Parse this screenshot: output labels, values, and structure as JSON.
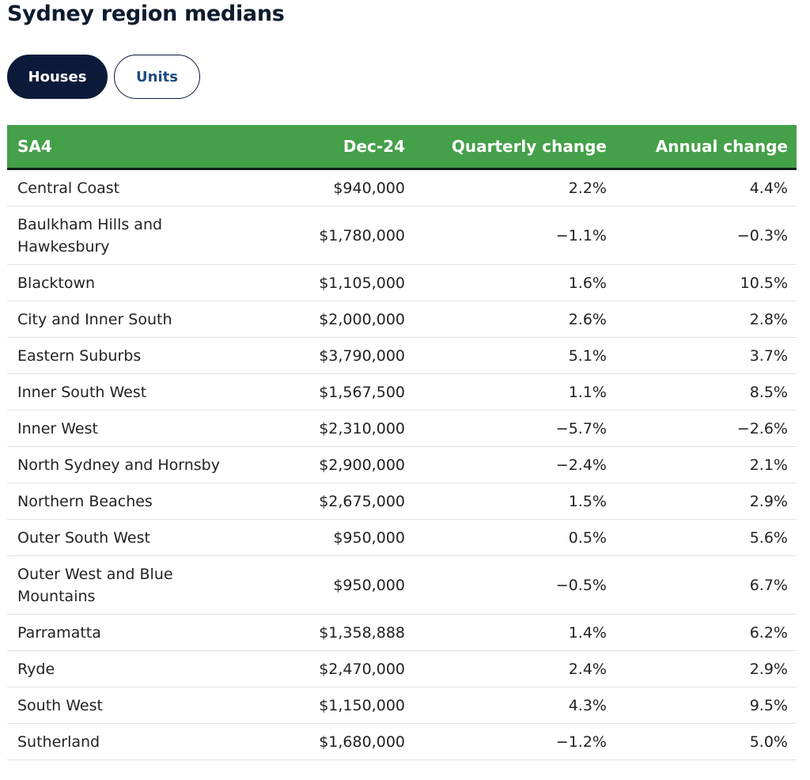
{
  "title": "Sydney region medians",
  "toggle": {
    "houses": "Houses",
    "units": "Units",
    "selected": "Houses"
  },
  "colors": {
    "header_bg": "#45a04a",
    "active_button": "#0c1a3a",
    "units_text": "#1d4c80"
  },
  "table": {
    "headers": [
      "SA4",
      "Dec-24",
      "Quarterly change",
      "Annual change"
    ],
    "rows": [
      [
        "Central Coast",
        "$940,000",
        "2.2%",
        "4.4%"
      ],
      [
        "Baulkham Hills and Hawkesbury",
        "$1,780,000",
        "−1.1%",
        "−0.3%"
      ],
      [
        "Blacktown",
        "$1,105,000",
        "1.6%",
        "10.5%"
      ],
      [
        "City and Inner South",
        "$2,000,000",
        "2.6%",
        "2.8%"
      ],
      [
        "Eastern Suburbs",
        "$3,790,000",
        "5.1%",
        "3.7%"
      ],
      [
        "Inner South West",
        "$1,567,500",
        "1.1%",
        "8.5%"
      ],
      [
        "Inner West",
        "$2,310,000",
        "−5.7%",
        "−2.6%"
      ],
      [
        "North Sydney and Hornsby",
        "$2,900,000",
        "−2.4%",
        "2.1%"
      ],
      [
        "Northern Beaches",
        "$2,675,000",
        "1.5%",
        "2.9%"
      ],
      [
        "Outer South West",
        "$950,000",
        "0.5%",
        "5.6%"
      ],
      [
        "Outer West and Blue Mountains",
        "$950,000",
        "−0.5%",
        "6.7%"
      ],
      [
        "Parramatta",
        "$1,358,888",
        "1.4%",
        "6.2%"
      ],
      [
        "Ryde",
        "$2,470,000",
        "2.4%",
        "2.9%"
      ],
      [
        "South West",
        "$1,150,000",
        "4.3%",
        "9.5%"
      ],
      [
        "Sutherland",
        "$1,680,000",
        "−1.2%",
        "5.0%"
      ]
    ]
  }
}
